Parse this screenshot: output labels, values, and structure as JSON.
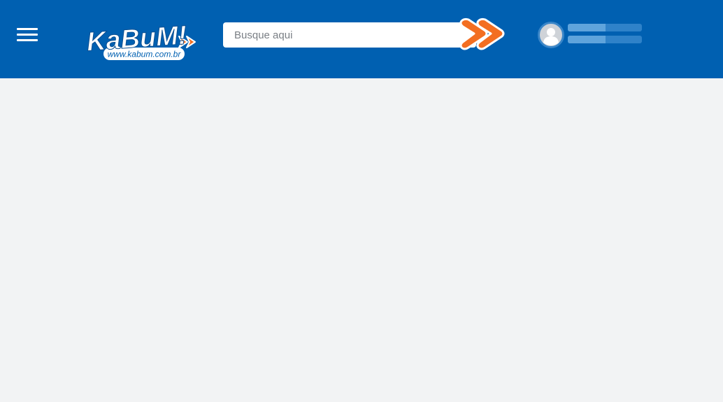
{
  "header": {
    "background_color": "#0060b1",
    "menu_icon": "hamburger-menu-icon",
    "logo": {
      "text": "KaBuM!",
      "url_text": "www.kabum.com.br",
      "accent_color": "#f36e21"
    },
    "search": {
      "placeholder": "Busque aqui",
      "value": "",
      "button_icon": "double-chevron-right-icon",
      "button_color": "#f36e21"
    },
    "account": {
      "avatar_icon": "user-avatar-icon"
    }
  },
  "main": {
    "background_color": "#f2f3f4"
  }
}
